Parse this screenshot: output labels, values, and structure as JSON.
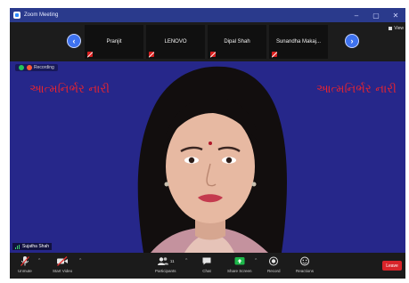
{
  "window": {
    "title": "Zoom Meeting",
    "controls": [
      "–",
      "▢",
      "✕"
    ]
  },
  "strip": {
    "prev_icon": "chevron-left-icon",
    "next_icon": "chevron-right-icon",
    "participants": [
      {
        "name": "Pranjit",
        "muted": true
      },
      {
        "name": "LENOVO",
        "muted": true
      },
      {
        "name": "Dipal Shah",
        "muted": true
      },
      {
        "name": "Sunandha  Makaj...",
        "muted": true
      }
    ],
    "view_label": "View"
  },
  "main": {
    "recording_label": "Recording",
    "banner_left": "આત્મનિર્ભર નારી",
    "banner_right": "આત્મનિર્ભર નારી",
    "speaker_name": "Sujatha Shah",
    "background_color": "#26278a"
  },
  "toolbar": {
    "items": [
      {
        "label": "Unmute",
        "icon": "microphone-muted-icon"
      },
      {
        "label": "Start Video",
        "icon": "video-off-icon"
      },
      {
        "label": "Participants",
        "icon": "participants-icon",
        "count": "11"
      },
      {
        "label": "Chat",
        "icon": "chat-icon"
      },
      {
        "label": "Share Screen",
        "icon": "share-screen-icon"
      },
      {
        "label": "Record",
        "icon": "record-icon"
      },
      {
        "label": "Reactions",
        "icon": "reactions-icon"
      }
    ],
    "leave_label": "Leave",
    "colors": {
      "share": "#1db84a",
      "leave": "#d8242a"
    }
  }
}
